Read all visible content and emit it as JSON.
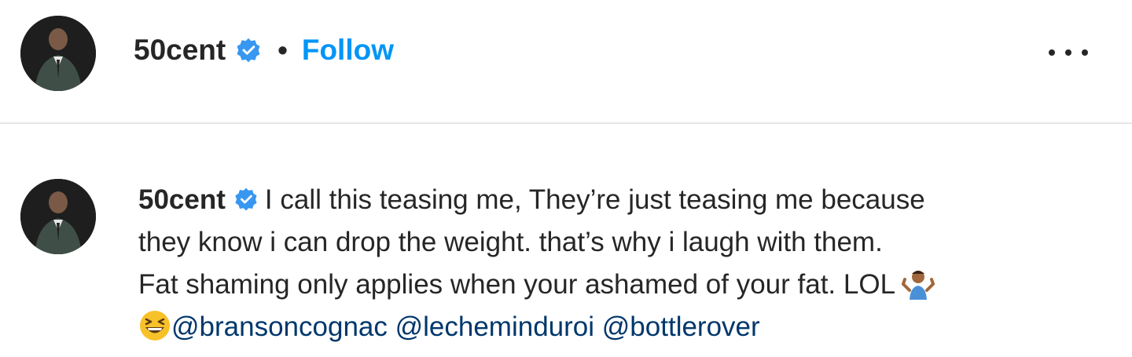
{
  "post": {
    "username": "50cent",
    "separator": "•",
    "follow_label": "Follow",
    "avatar_icon": "profile-photo",
    "verified_icon": "verified-badge-icon",
    "more_icon": "more-options-icon"
  },
  "caption": {
    "username": "50cent",
    "lines": [
      "I call this teasing me, They’re just teasing me because",
      "they know i can drop the weight. that’s why i laugh with them.",
      "Fat shaming only applies when your ashamed of your fat. LOL"
    ],
    "emojis": [
      "shrug-emoji",
      "grinning-squinting-emoji"
    ],
    "mentions": [
      "@bransoncognac",
      "@lecheminduroi",
      "@bottlerover"
    ]
  },
  "colors": {
    "link_blue": "#0095f6",
    "mention": "#00376b",
    "text": "#262626",
    "divider": "#e6e6e6",
    "verified": "#3897f0"
  }
}
